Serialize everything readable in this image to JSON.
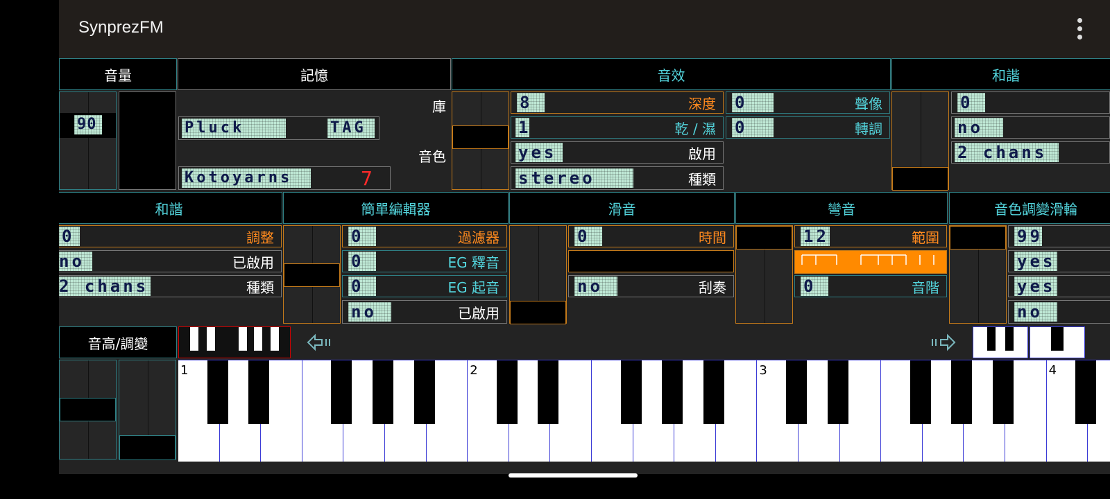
{
  "app": {
    "title": "SynprezFM",
    "menu_icon": "overflow-menu-icon"
  },
  "sections": {
    "volume": "音量",
    "memory": "記憶",
    "effect": "音效",
    "harmony": "和諧",
    "harmony2": "和諧",
    "simple_editor": "簡單編輯器",
    "portamento": "滑音",
    "bend": "彎音",
    "mod_wheel": "音色調變滑輪",
    "pitch_mod": "音高/調變"
  },
  "volume": {
    "value": "90"
  },
  "memory": {
    "bank_label": "庫",
    "bank_name": "Pluck",
    "bank_tag": "TAG",
    "voice_label": "音色",
    "voice_name": "Kotoyarns",
    "voice_number": "7"
  },
  "effect": {
    "depth": {
      "value": "8",
      "label": "深度"
    },
    "dry_wet": {
      "value": "1",
      "label": "乾 / 濕"
    },
    "enabled": {
      "value": "yes",
      "label": "啟用"
    },
    "type": {
      "value": "stereo",
      "label": "種類"
    },
    "pan": {
      "value": "0",
      "label": "聲像"
    },
    "transpose": {
      "value": "0",
      "label": "轉調"
    }
  },
  "harmony_top": {
    "v1": "0",
    "v2": "no",
    "v3": "2 chans"
  },
  "harmony": {
    "adjust": {
      "value": "0",
      "label": "調整"
    },
    "enabled": {
      "value": "no",
      "label": "已啟用"
    },
    "type": {
      "value": "2 chans",
      "label": "種類"
    }
  },
  "simple_editor": {
    "filter": {
      "value": "0",
      "label": "過濾器"
    },
    "eg_release": {
      "value": "0",
      "label": "EG 釋音"
    },
    "eg_attack": {
      "value": "0",
      "label": "EG 起音"
    },
    "enabled": {
      "value": "no",
      "label": "已啟用"
    }
  },
  "portamento": {
    "time": {
      "value": "0",
      "label": "時間"
    },
    "arp": {
      "value": "no",
      "label": "刮奏"
    }
  },
  "bend": {
    "range": {
      "value": "12",
      "label": "範圍"
    },
    "step": {
      "value": "0",
      "label": "音階"
    }
  },
  "mod_wheel": {
    "v1": "99",
    "v2": "yes",
    "v3": "yes",
    "v4": "no"
  },
  "keyboard": {
    "octaves": [
      "1",
      "2",
      "3",
      "4"
    ]
  },
  "colors": {
    "accent_orange": "#ff8a1e",
    "accent_cyan": "#53d4dc",
    "border_teal": "#2e7f84"
  }
}
